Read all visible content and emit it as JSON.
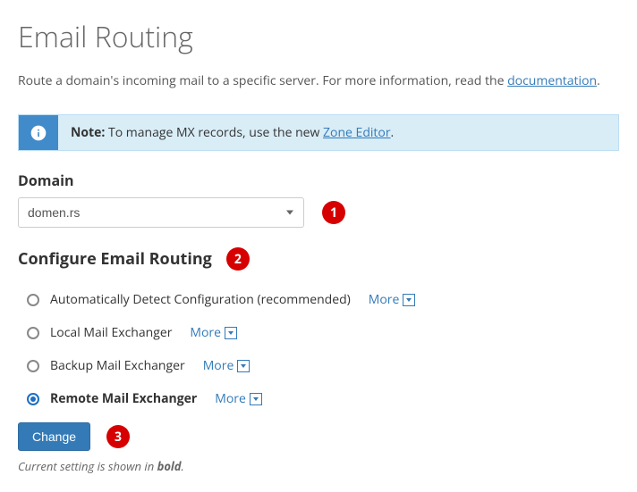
{
  "page": {
    "title": "Email Routing",
    "intro_prefix": "Route a domain's incoming mail to a specific server. For more information, read the ",
    "intro_link": "documentation",
    "intro_suffix": "."
  },
  "note": {
    "bold": "Note:",
    "text_before": " To manage MX records, use the new ",
    "link": "Zone Editor",
    "text_after": "."
  },
  "domain": {
    "label": "Domain",
    "selected": "domen.rs"
  },
  "config": {
    "label": "Configure Email Routing",
    "more_label": "More",
    "options": [
      {
        "label": "Automatically Detect Configuration (recommended)",
        "selected": false
      },
      {
        "label": "Local Mail Exchanger",
        "selected": false
      },
      {
        "label": "Backup Mail Exchanger",
        "selected": false
      },
      {
        "label": "Remote Mail Exchanger",
        "selected": true
      }
    ]
  },
  "buttons": {
    "change": "Change"
  },
  "helper": {
    "prefix": "Current setting is shown in ",
    "bold": "bold",
    "suffix": "."
  },
  "annotations": {
    "1": "1",
    "2": "2",
    "3": "3"
  }
}
